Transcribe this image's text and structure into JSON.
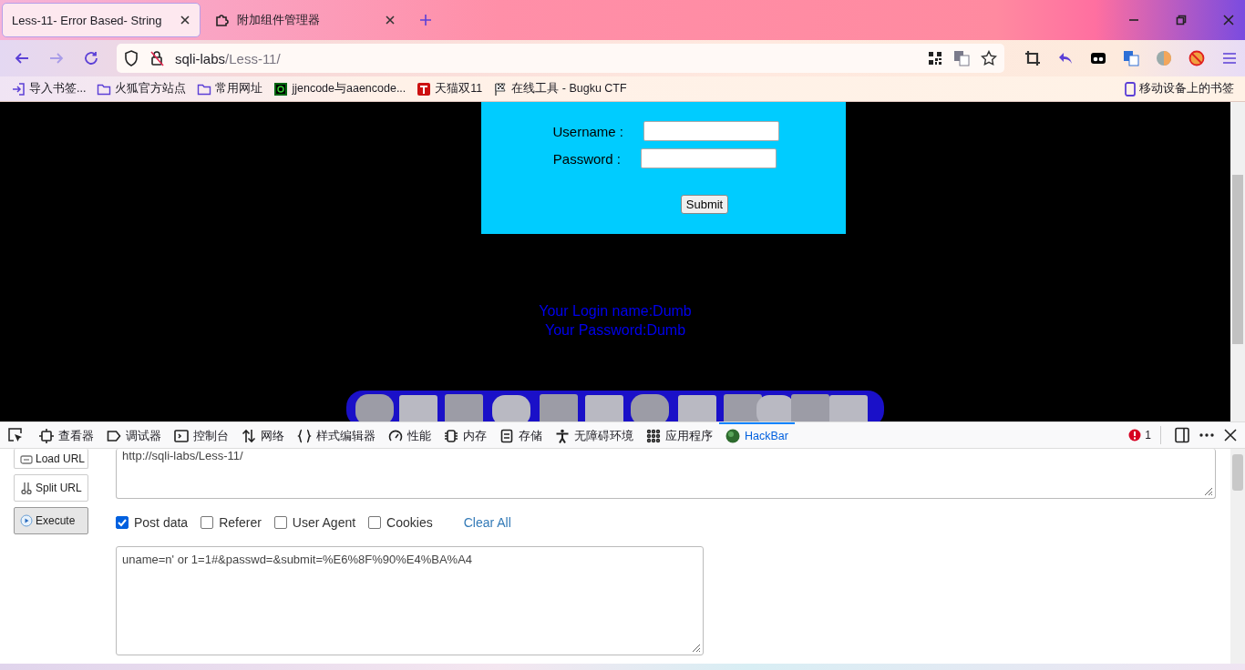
{
  "browser": {
    "tabs": [
      {
        "title": "Less-11- Error Based- String",
        "kind": "none",
        "selected": true
      },
      {
        "title": "附加组件管理器",
        "kind": "puzzle",
        "selected": false
      }
    ],
    "address": {
      "host": "sqli-labs",
      "path": "/Less-11/"
    },
    "bookmarks": [
      {
        "label": "导入书签...",
        "kind": "import"
      },
      {
        "label": "火狐官方站点",
        "kind": "folder"
      },
      {
        "label": "常用网址",
        "kind": "folder"
      },
      {
        "label": "jjencode与aaencode...",
        "kind": "green-logo"
      },
      {
        "label": "天猫双11",
        "kind": "red-logo"
      },
      {
        "label": "在线工具 - Bugku CTF",
        "kind": "flag"
      }
    ],
    "mobile_bookmarks": "移动设备上的书签"
  },
  "page": {
    "form": {
      "username_label": "Username :",
      "password_label": "Password :",
      "submit": "Submit"
    },
    "result": [
      "Your Login name:Dumb",
      "Your Password:Dumb"
    ],
    "banner": {
      "kind": "picture"
    }
  },
  "devtools": {
    "tabs": [
      {
        "label": "查看器",
        "kind": "inspector",
        "selected": false
      },
      {
        "label": "调试器",
        "kind": "debugger",
        "selected": false
      },
      {
        "label": "控制台",
        "kind": "console",
        "selected": false
      },
      {
        "label": "网络",
        "kind": "network",
        "selected": false
      },
      {
        "label": "样式编辑器",
        "kind": "style",
        "selected": false
      },
      {
        "label": "性能",
        "kind": "performance",
        "selected": false
      },
      {
        "label": "内存",
        "kind": "memory",
        "selected": false
      },
      {
        "label": "存储",
        "kind": "storage",
        "selected": false
      },
      {
        "label": "无障碍环境",
        "kind": "accessibility",
        "selected": false
      },
      {
        "label": "应用程序",
        "kind": "apps",
        "selected": false
      },
      {
        "label": "HackBar",
        "kind": "hackbar",
        "selected": true
      }
    ],
    "error_count": "1"
  },
  "hackbar": {
    "buttons": [
      {
        "label": "Load URL",
        "kind": "link",
        "pressed": false
      },
      {
        "label": "Split URL",
        "kind": "scissors",
        "pressed": false
      },
      {
        "label": "Execute",
        "kind": "play",
        "pressed": true
      }
    ],
    "url": "http://sqli-labs/Less-11/",
    "options": [
      {
        "label": "Post data",
        "checked": true
      },
      {
        "label": "Referer",
        "checked": false
      },
      {
        "label": "User Agent",
        "checked": false
      },
      {
        "label": "Cookies",
        "checked": false
      }
    ],
    "clear_all": "Clear All",
    "post_data": "uname=n' or 1=1#&passwd=&submit=%E6%8F%90%E4%BA%A4"
  }
}
